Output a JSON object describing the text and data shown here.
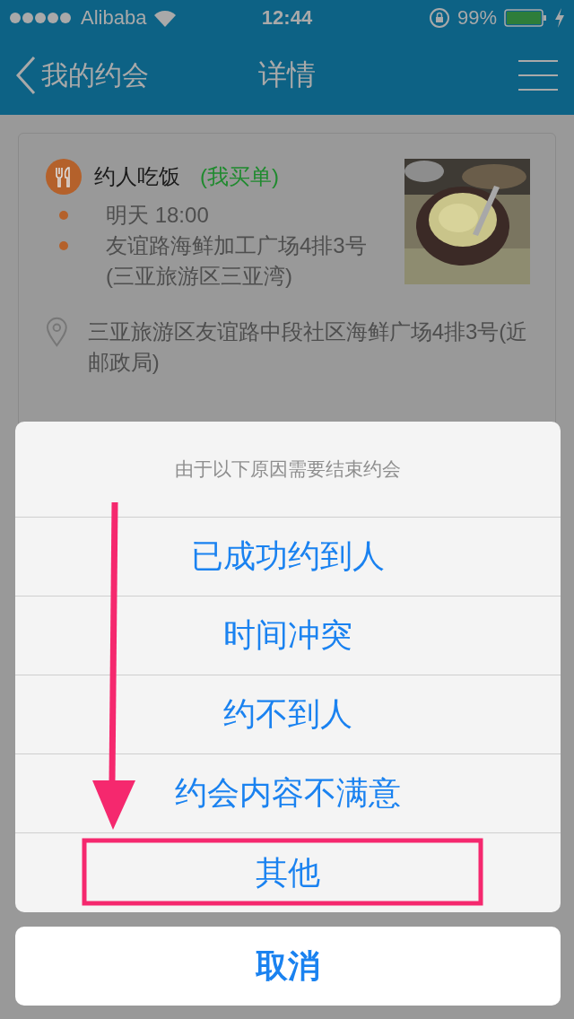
{
  "status_bar": {
    "carrier": "Alibaba",
    "time": "12:44",
    "battery_text": "99%"
  },
  "nav": {
    "back_label": "我的约会",
    "title": "详情"
  },
  "card": {
    "category": "约人吃饭",
    "payer": "(我买单)",
    "time": "明天 18:00",
    "venue": "友谊路海鲜加工广场4排3号(三亚旅游区三亚湾)",
    "address": "三亚旅游区友谊路中段社区海鲜广场4排3号(近邮政局)"
  },
  "sheet": {
    "title": "由于以下原因需要结束约会",
    "options": [
      "已成功约到人",
      "时间冲突",
      "约不到人",
      "约会内容不满意",
      "其他"
    ],
    "cancel": "取消"
  }
}
